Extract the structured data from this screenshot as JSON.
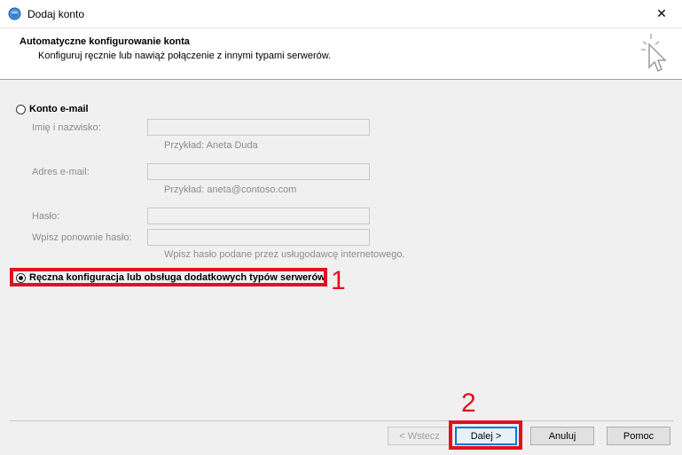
{
  "window": {
    "title": "Dodaj konto",
    "close_glyph": "✕"
  },
  "header": {
    "title": "Automatyczne konfigurowanie konta",
    "subtitle": "Konfiguruj ręcznie lub nawiąż połączenie z innymi typami serwerów."
  },
  "email_option": {
    "label": "Konto e-mail",
    "selected": false,
    "name_label": "Imię i nazwisko:",
    "name_value": "",
    "name_hint": "Przykład: Aneta Duda",
    "email_label": "Adres e-mail:",
    "email_value": "",
    "email_hint": "Przykład: aneta@contoso.com",
    "password_label": "Hasło:",
    "password_value": "",
    "retype_label": "Wpisz ponownie hasło:",
    "retype_value": "",
    "password_hint": "Wpisz hasło podane przez usługodawcę internetowego."
  },
  "manual_option": {
    "label": "Ręczna konfiguracja lub obsługa dodatkowych typów serwerów",
    "selected": true
  },
  "annotations": {
    "step1": "1",
    "step2": "2",
    "color": "#e0121f"
  },
  "buttons": {
    "back": "< Wstecz",
    "next": "Dalej >",
    "cancel": "Anuluj",
    "help": "Pomoc"
  }
}
